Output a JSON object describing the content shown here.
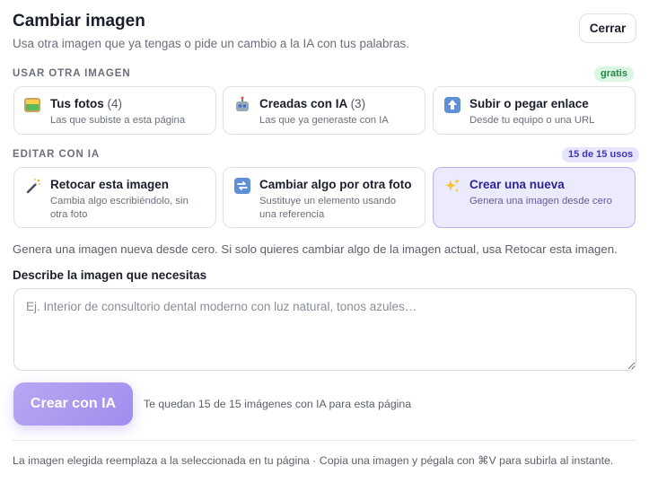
{
  "header": {
    "title": "Cambiar imagen",
    "subtitle": "Usa otra imagen que ya tengas o pide un cambio a la IA con tus palabras.",
    "close_label": "Cerrar"
  },
  "use_other": {
    "label": "USAR OTRA IMAGEN",
    "badge": "gratis",
    "cards": [
      {
        "icon": "photo-icon",
        "title": "Tus fotos",
        "count": "(4)",
        "desc": "Las que subiste a esta página"
      },
      {
        "icon": "robot-icon",
        "title": "Creadas con IA",
        "count": "(3)",
        "desc": "Las que ya generaste con IA"
      },
      {
        "icon": "upload-arrow-icon",
        "title": "Subir o pegar enlace",
        "count": "",
        "desc": "Desde tu equipo o una URL"
      }
    ]
  },
  "edit_ai": {
    "label": "EDITAR CON IA",
    "badge": "15 de 15 usos",
    "cards": [
      {
        "icon": "magic-wand-icon",
        "title": "Retocar esta imagen",
        "desc": "Cambia algo escribiéndolo, sin otra foto",
        "selected": false
      },
      {
        "icon": "swap-arrows-icon",
        "title": "Cambiar algo por otra foto",
        "desc": "Sustituye un elemento usando una referencia",
        "selected": false
      },
      {
        "icon": "sparkles-icon",
        "title": "Crear una nueva",
        "desc": "Genera una imagen desde cero",
        "selected": true
      }
    ]
  },
  "hint": "Genera una imagen nueva desde cero. Si solo quieres cambiar algo de la imagen actual, usa Retocar esta imagen.",
  "prompt": {
    "label": "Describe la imagen que necesitas",
    "value": "",
    "placeholder": "Ej. Interior de consultorio dental moderno con luz natural, tonos azules…"
  },
  "actions": {
    "create_label": "Crear con IA",
    "quota_text": "Te quedan 15 de 15 imágenes con IA para esta página"
  },
  "footer": "La imagen elegida reemplaza a la seleccionada en tu página · Copia una imagen y pégala con ⌘V para subirla al instante.",
  "colors": {
    "accent": "#a28ced",
    "selected_card_bg": "#eceafd",
    "badge_free_bg": "#dcf6e4",
    "badge_usage_bg": "#e7e5fb"
  }
}
